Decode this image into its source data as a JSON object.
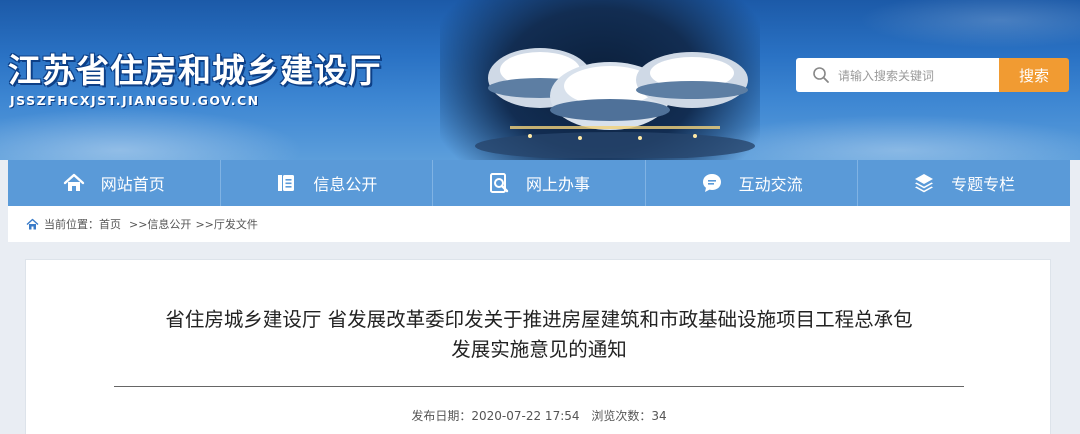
{
  "header": {
    "site_title": "江苏省住房和城乡建设厅",
    "site_url": "JSSZFHCXJST.JIANGSU.GOV.CN",
    "search": {
      "placeholder": "请输入搜索关键词",
      "button_label": "搜索"
    }
  },
  "nav": {
    "items": [
      {
        "label": "网站首页",
        "icon": "home-icon"
      },
      {
        "label": "信息公开",
        "icon": "document-icon"
      },
      {
        "label": "网上办事",
        "icon": "search-document-icon"
      },
      {
        "label": "互动交流",
        "icon": "chat-icon"
      },
      {
        "label": "专题专栏",
        "icon": "layers-icon"
      }
    ]
  },
  "breadcrumb": {
    "prefix": "当前位置：",
    "items": [
      "首页",
      ">>信息公开",
      ">>厅发文件"
    ]
  },
  "article": {
    "title_line1": "省住房城乡建设厅 省发展改革委印发关于推进房屋建筑和市政基础设施项目工程总承包",
    "title_line2": "发展实施意见的通知",
    "publish_label": "发布日期：",
    "publish_date": "2020-07-22 17:54",
    "views_label": "浏览次数：",
    "views": "34"
  },
  "colors": {
    "nav_bg": "#5a9ad8",
    "search_button": "#f19b32",
    "banner_blue": "#2a72c4"
  }
}
